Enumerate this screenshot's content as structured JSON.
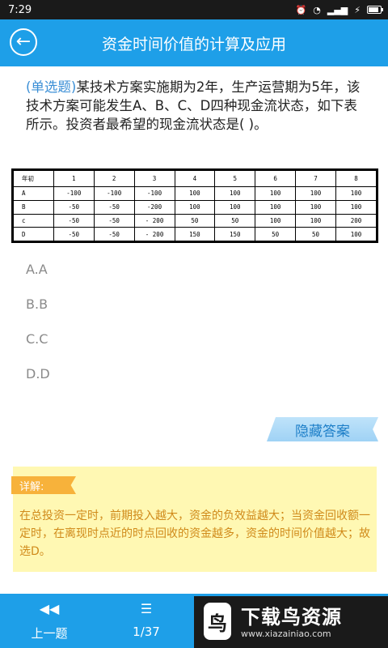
{
  "status_bar": {
    "time": "7:29"
  },
  "header": {
    "title": "资金时间价值的计算及应用"
  },
  "question": {
    "type_label": "(单选题)",
    "text": "某技术方案实施期为2年，生产运营期为5年，该技术方案可能发生A、B、C、D四种现金流状态，如下表所示。投资者最希望的现金流状态是(  )。"
  },
  "table": {
    "rows": [
      [
        "年初",
        "1",
        "2",
        "3",
        "4",
        "5",
        "6",
        "7",
        "8"
      ],
      [
        "A",
        "-100",
        "-100",
        "-100",
        "100",
        "100",
        "100",
        "100",
        "100"
      ],
      [
        "B",
        "-50",
        "-50",
        "-200",
        "100",
        "100",
        "100",
        "100",
        "100"
      ],
      [
        "c",
        "-50",
        "-50",
        "- 200",
        "50",
        "50",
        "100",
        "100",
        "200"
      ],
      [
        "D",
        "-50",
        "-50",
        "- 200",
        "150",
        "150",
        "50",
        "50",
        "100"
      ]
    ]
  },
  "options": [
    "A.A",
    "B.B",
    "C.C",
    "D.D"
  ],
  "hide_answer_label": "隐藏答案",
  "explanation": {
    "tag": "详解:",
    "text": "在总投资一定时，前期投入越大，资金的负效益越大；当资金回收额一定时，在离现时点近的时点回收的资金越多，资金的时间价值越大；故选D。"
  },
  "bottom_nav": {
    "prev_label": "上一题",
    "progress": "1/37"
  },
  "watermark": {
    "title": "下载鸟资源",
    "url": "www.xiazainiao.com"
  },
  "colors": {
    "primary": "#1e9fe8",
    "explain_bg": "#fff8b3",
    "explain_text": "#d08a1a",
    "tag_bg": "#f7b23b"
  }
}
